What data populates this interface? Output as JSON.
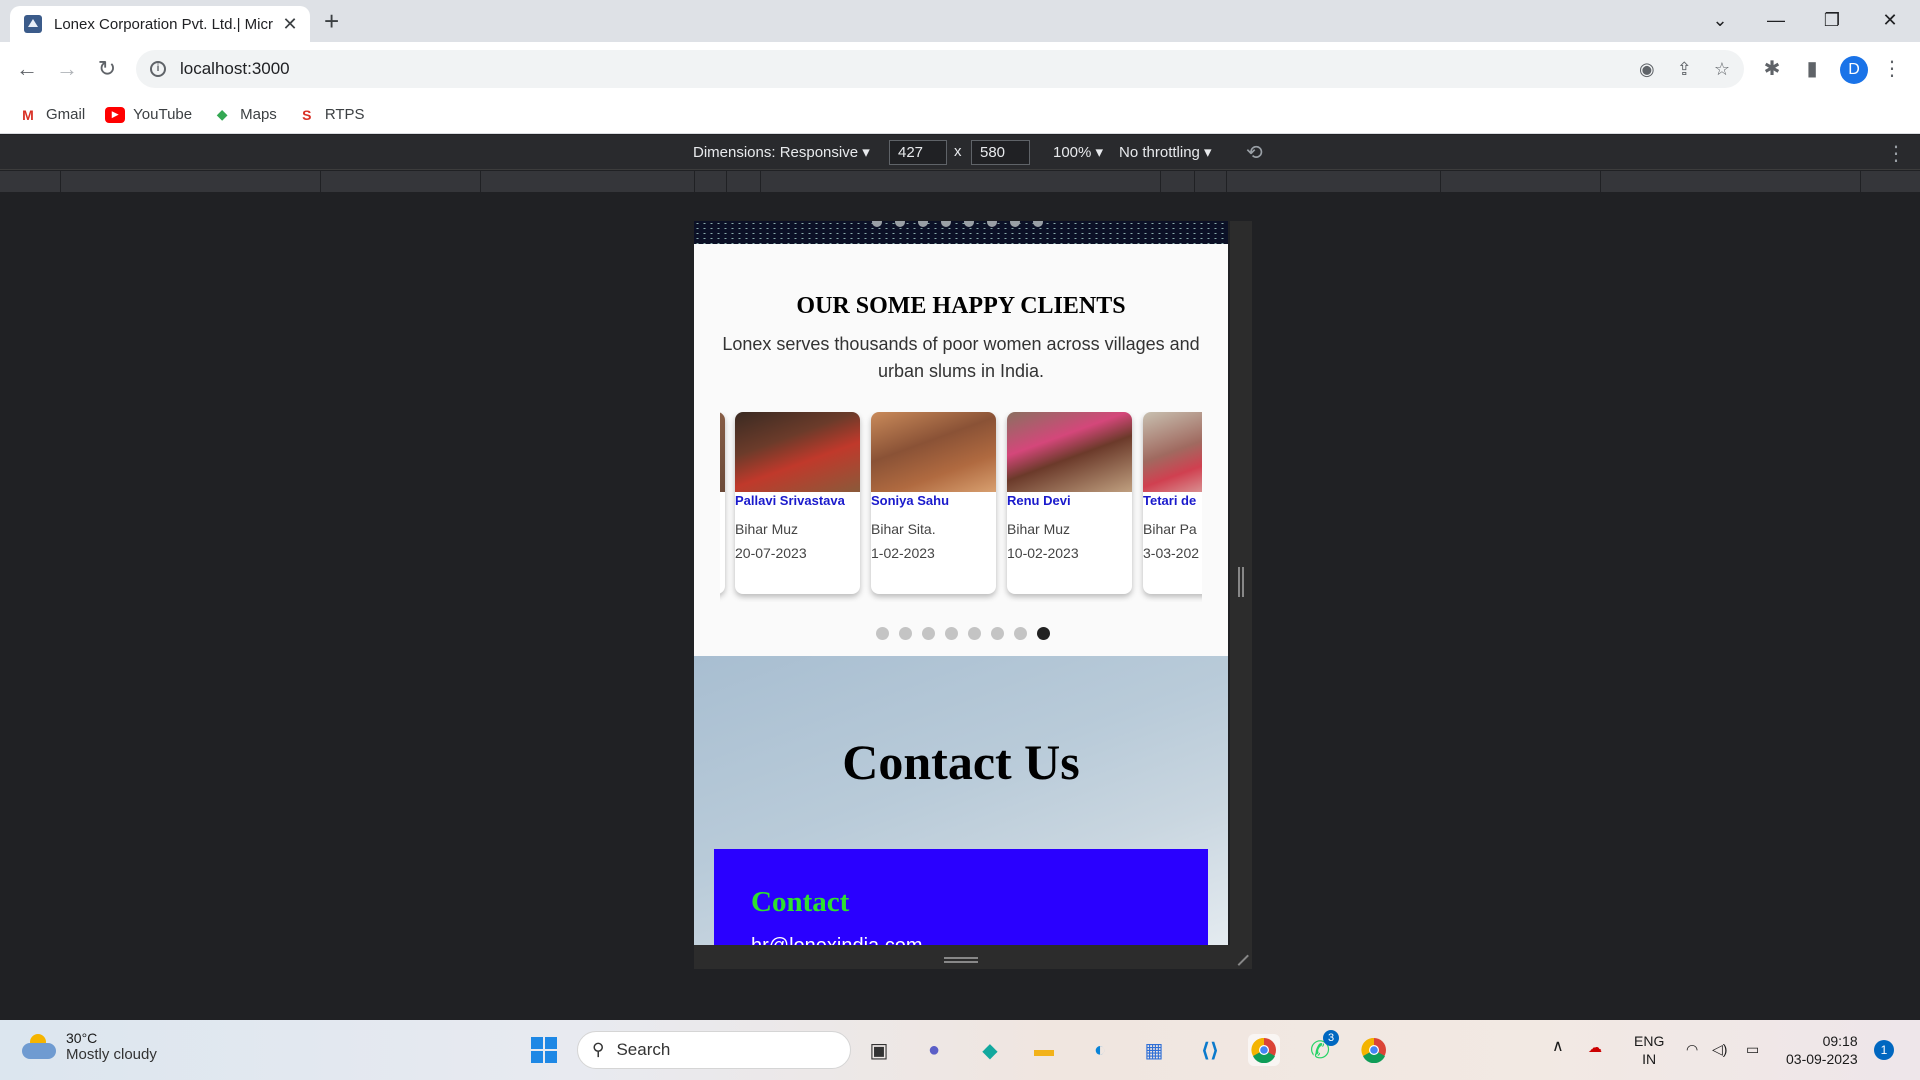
{
  "browser": {
    "tab_title": "Lonex Corporation Pvt. Ltd.| Micr",
    "url": "localhost:3000",
    "profile_initial": "D",
    "bookmarks": [
      {
        "label": "Gmail",
        "icon": "gmail-icon"
      },
      {
        "label": "YouTube",
        "icon": "youtube-icon"
      },
      {
        "label": "Maps",
        "icon": "maps-icon"
      },
      {
        "label": "RTPS",
        "icon": "rtps-icon"
      }
    ]
  },
  "devtools": {
    "dimensions_label": "Dimensions: Responsive ▾",
    "width": "427",
    "height": "580",
    "times": "x",
    "zoom": "100% ▾",
    "throttling": "No throttling ▾"
  },
  "page": {
    "clients_title": "OUR SOME HAPPY CLIENTS",
    "clients_subtitle": "Lonex serves thousands of poor women across villages and urban slums in India.",
    "clients": [
      {
        "name": "Pallavi Srivastava",
        "place": "Bihar Muz",
        "date": "20-07-2023"
      },
      {
        "name": "Soniya Sahu",
        "place": "Bihar Sita.",
        "date": "1-02-2023"
      },
      {
        "name": "Renu Devi",
        "place": "Bihar Muz",
        "date": "10-02-2023"
      },
      {
        "name": "Tetari de",
        "place": "Bihar Pa",
        "date": "3-03-202"
      }
    ],
    "carousel_active_dot": 8,
    "carousel_dot_count": 8,
    "contact_title": "Contact Us",
    "contact_box_heading": "Contact",
    "contact_email": "hr@lonexindia.com",
    "colors": {
      "contact_box": "#2a00ff",
      "contact_heading": "#2ee02e",
      "client_name": "#1a1acc"
    }
  },
  "taskbar": {
    "temperature": "30°C",
    "weather": "Mostly cloudy",
    "search_placeholder": "Search",
    "language": "ENG",
    "region": "IN",
    "time": "09:18",
    "date": "03-09-2023",
    "notification_count": "1",
    "whatsapp_badge": "3"
  }
}
